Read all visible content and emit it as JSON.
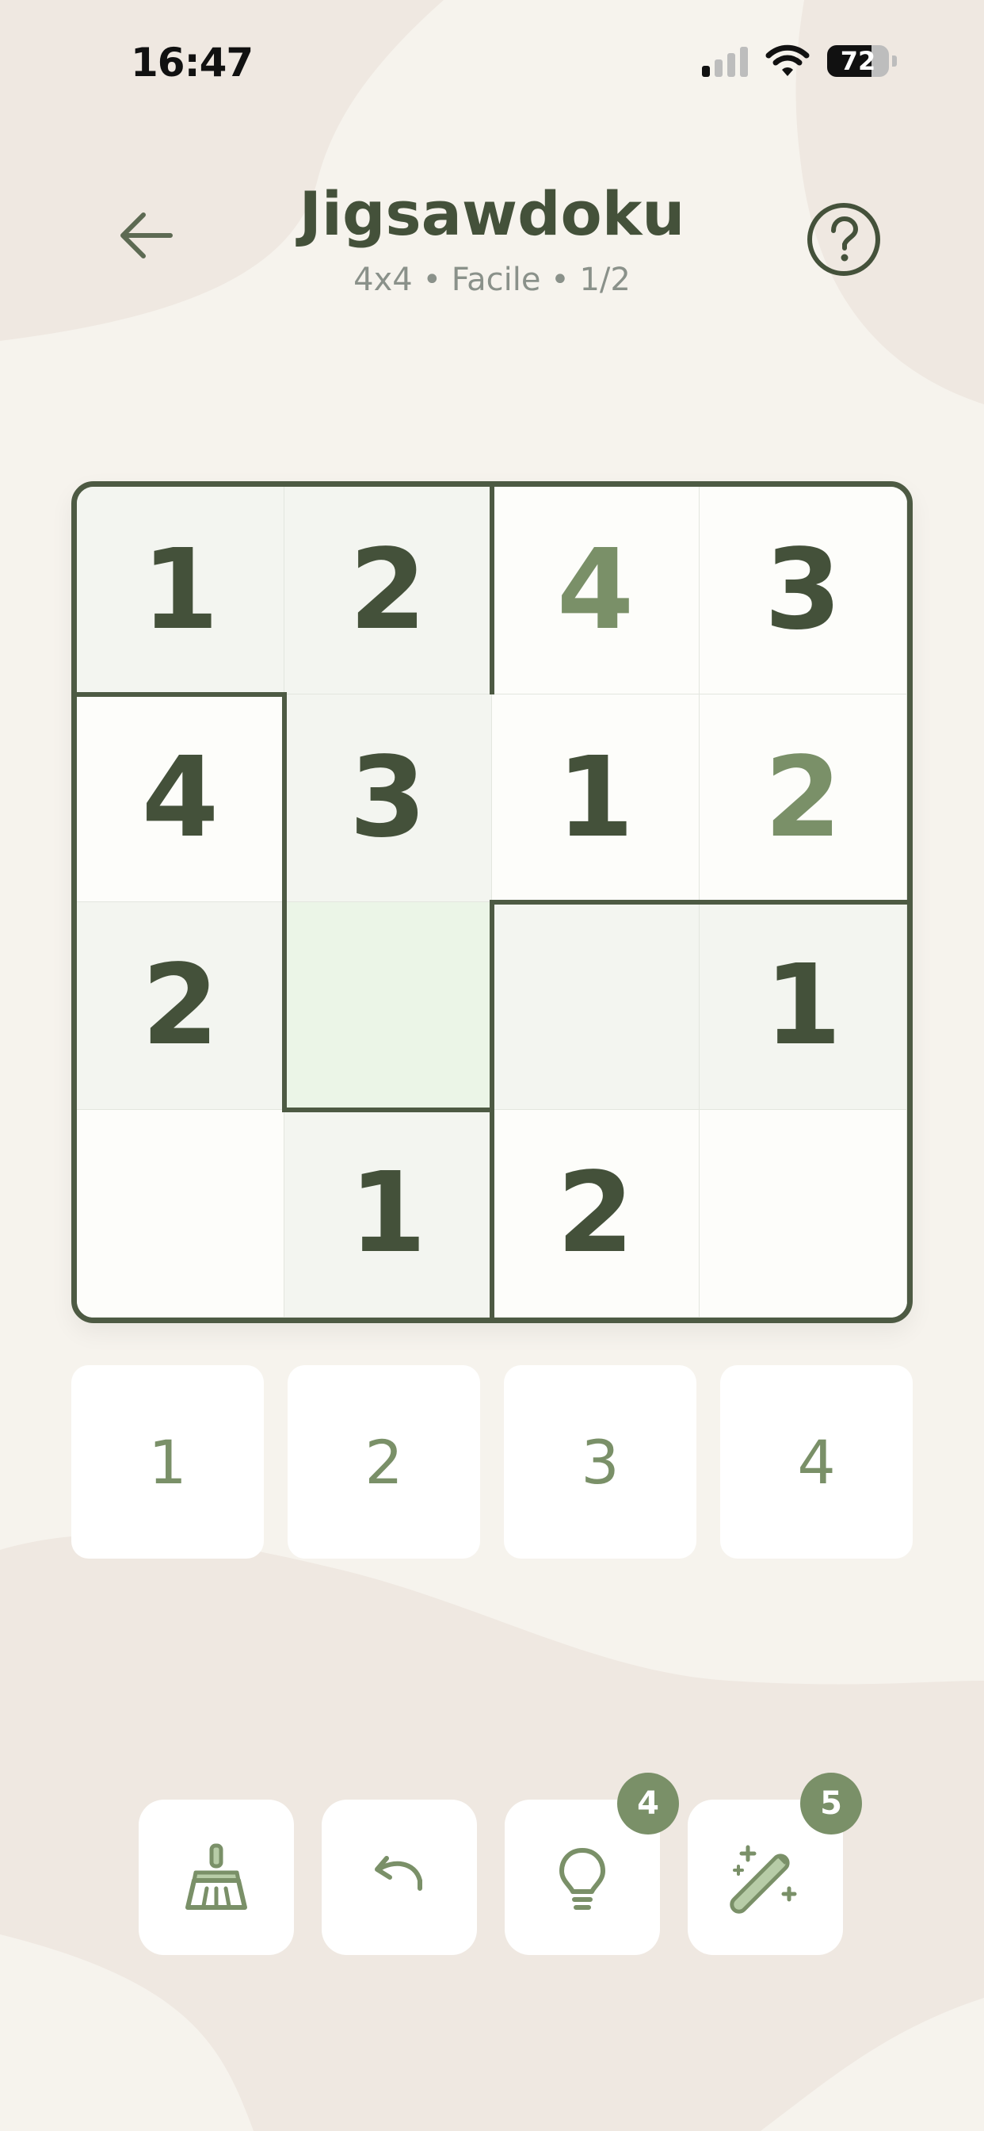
{
  "status": {
    "time": "16:47",
    "battery": "72",
    "battery_level": 0.72
  },
  "header": {
    "title": "Jigsawdoku",
    "subtitle": "4x4 • Facile • 1/2"
  },
  "board": {
    "rows": [
      [
        "1",
        "2",
        "4",
        "3"
      ],
      [
        "4",
        "3",
        "1",
        "2"
      ],
      [
        "2",
        "",
        "",
        "1"
      ],
      [
        "",
        "1",
        "2",
        ""
      ]
    ]
  },
  "numpad": [
    "1",
    "2",
    "3",
    "4"
  ],
  "tools": {
    "hint_count": "4",
    "magic_count": "5"
  },
  "colors": {
    "accent": "#7a9068",
    "dark": "#44513a",
    "selected": "#ebf5e7",
    "shade": "#f3f5f0"
  },
  "icons": [
    "back-arrow-icon",
    "help-icon",
    "broom-icon",
    "undo-icon",
    "lightbulb-icon",
    "magic-wand-icon",
    "signal-icon",
    "wifi-icon",
    "battery-icon"
  ]
}
